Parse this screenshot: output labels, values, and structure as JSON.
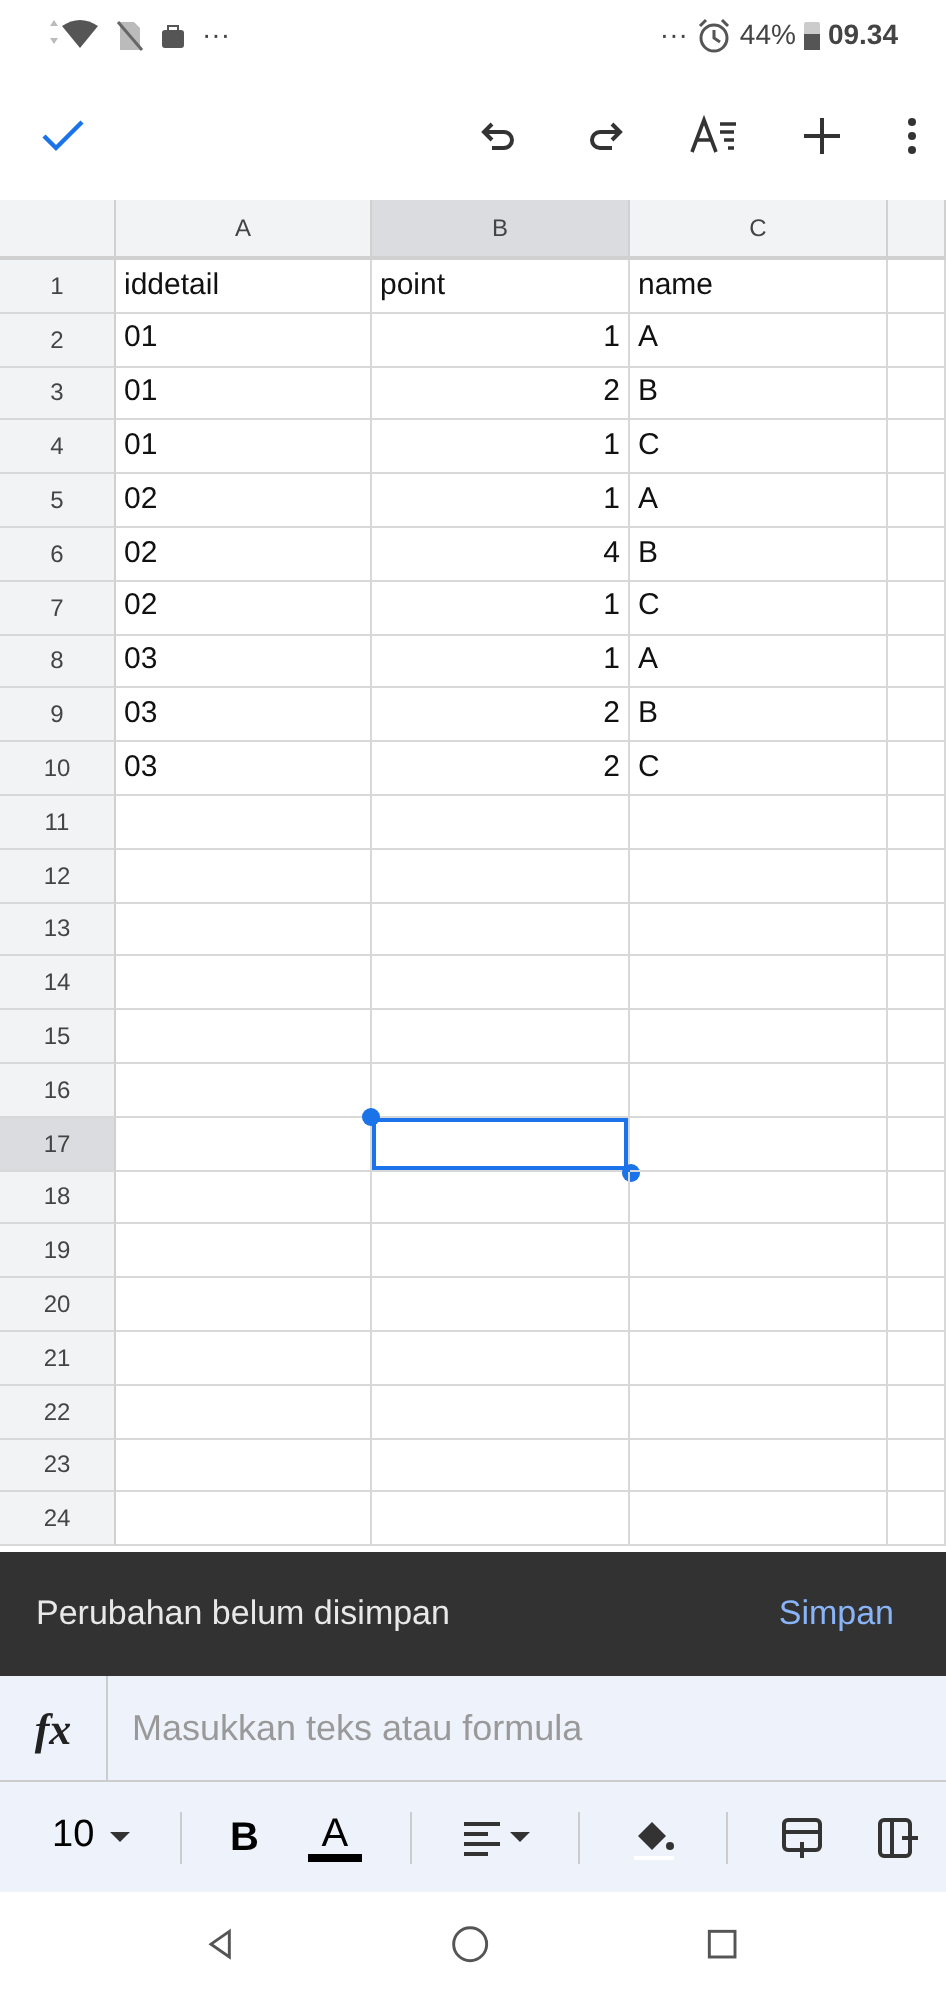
{
  "status_bar": {
    "left_more": "···",
    "right_more": "···",
    "battery": "44%",
    "time": "09.34"
  },
  "columns": [
    {
      "label": "A",
      "selected": false
    },
    {
      "label": "B",
      "selected": true
    },
    {
      "label": "C",
      "selected": false
    }
  ],
  "rows": [
    {
      "number": "1",
      "selected": false,
      "cells": [
        {
          "text": "iddetail",
          "kind": "text"
        },
        {
          "text": "point",
          "kind": "text"
        },
        {
          "text": "name",
          "kind": "text"
        }
      ]
    },
    {
      "number": "2",
      "selected": false,
      "cells": [
        {
          "text": "01",
          "kind": "text"
        },
        {
          "text": "1",
          "kind": "number"
        },
        {
          "text": "A",
          "kind": "text"
        }
      ]
    },
    {
      "number": "3",
      "selected": false,
      "cells": [
        {
          "text": "01",
          "kind": "text"
        },
        {
          "text": "2",
          "kind": "number"
        },
        {
          "text": "B",
          "kind": "text"
        }
      ]
    },
    {
      "number": "4",
      "selected": false,
      "cells": [
        {
          "text": "01",
          "kind": "text"
        },
        {
          "text": "1",
          "kind": "number"
        },
        {
          "text": "C",
          "kind": "text"
        }
      ]
    },
    {
      "number": "5",
      "selected": false,
      "cells": [
        {
          "text": "02",
          "kind": "text"
        },
        {
          "text": "1",
          "kind": "number"
        },
        {
          "text": "A",
          "kind": "text"
        }
      ]
    },
    {
      "number": "6",
      "selected": false,
      "cells": [
        {
          "text": "02",
          "kind": "text"
        },
        {
          "text": "4",
          "kind": "number"
        },
        {
          "text": "B",
          "kind": "text"
        }
      ]
    },
    {
      "number": "7",
      "selected": false,
      "cells": [
        {
          "text": "02",
          "kind": "text"
        },
        {
          "text": "1",
          "kind": "number"
        },
        {
          "text": "C",
          "kind": "text"
        }
      ]
    },
    {
      "number": "8",
      "selected": false,
      "cells": [
        {
          "text": "03",
          "kind": "text"
        },
        {
          "text": "1",
          "kind": "number"
        },
        {
          "text": "A",
          "kind": "text"
        }
      ]
    },
    {
      "number": "9",
      "selected": false,
      "cells": [
        {
          "text": "03",
          "kind": "text"
        },
        {
          "text": "2",
          "kind": "number"
        },
        {
          "text": "B",
          "kind": "text"
        }
      ]
    },
    {
      "number": "10",
      "selected": false,
      "cells": [
        {
          "text": "03",
          "kind": "text"
        },
        {
          "text": "2",
          "kind": "number"
        },
        {
          "text": "C",
          "kind": "text"
        }
      ]
    },
    {
      "number": "11",
      "selected": false
    },
    {
      "number": "12",
      "selected": false
    },
    {
      "number": "13",
      "selected": false
    },
    {
      "number": "14",
      "selected": false
    },
    {
      "number": "15",
      "selected": false
    },
    {
      "number": "16",
      "selected": false
    },
    {
      "number": "17",
      "selected": true
    },
    {
      "number": "18",
      "selected": false
    },
    {
      "number": "19",
      "selected": false
    },
    {
      "number": "20",
      "selected": false
    },
    {
      "number": "21",
      "selected": false
    },
    {
      "number": "22",
      "selected": false
    },
    {
      "number": "23",
      "selected": false
    },
    {
      "number": "24",
      "selected": false
    }
  ],
  "snackbar": {
    "message": "Perubahan belum disimpan",
    "action": "Simpan"
  },
  "formula_bar": {
    "label": "fx",
    "placeholder": "Masukkan teks atau formula"
  },
  "format_toolbar": {
    "font_size": "10",
    "bold": "B",
    "text_color": "A"
  }
}
